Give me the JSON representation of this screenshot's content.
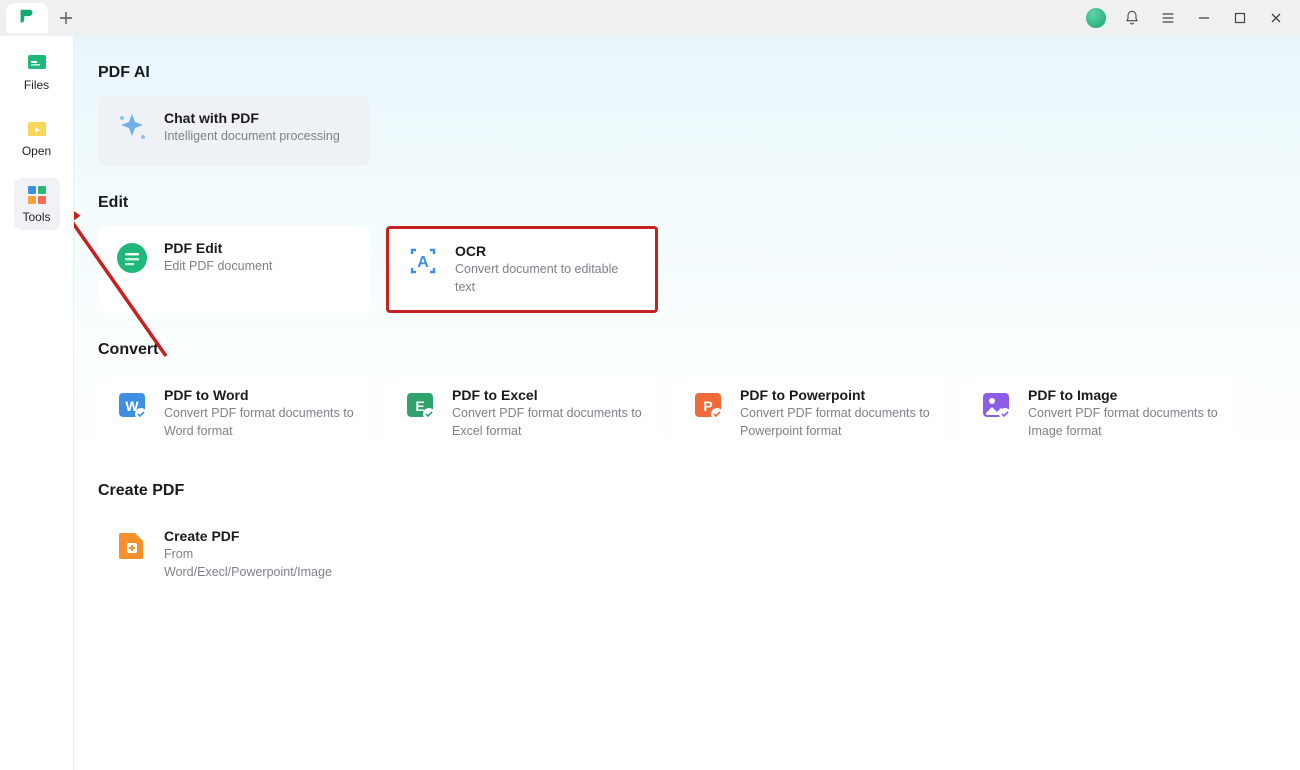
{
  "sidebar": {
    "items": [
      {
        "label": "Files"
      },
      {
        "label": "Open"
      },
      {
        "label": "Tools"
      }
    ]
  },
  "sections": {
    "ai": {
      "title": "PDF AI",
      "cards": [
        {
          "title": "Chat with PDF",
          "desc": "Intelligent document processing"
        }
      ]
    },
    "edit": {
      "title": "Edit",
      "cards": [
        {
          "title": "PDF Edit",
          "desc": "Edit PDF document"
        },
        {
          "title": "OCR",
          "desc": "Convert document to editable text"
        }
      ]
    },
    "convert": {
      "title": "Convert",
      "cards": [
        {
          "title": "PDF to Word",
          "desc": "Convert PDF format documents to Word format"
        },
        {
          "title": "PDF to Excel",
          "desc": "Convert PDF format documents to Excel format"
        },
        {
          "title": "PDF to Powerpoint",
          "desc": "Convert PDF format documents to Powerpoint format"
        },
        {
          "title": "PDF to Image",
          "desc": "Convert PDF format documents to Image format"
        }
      ]
    },
    "create": {
      "title": "Create PDF",
      "cards": [
        {
          "title": "Create PDF",
          "desc": "From Word/Execl/Powerpoint/Image"
        }
      ]
    }
  },
  "colors": {
    "highlight": "#c62020",
    "accent_green": "#16a871",
    "word_blue": "#3e8fe3",
    "excel_green": "#2fa36b",
    "ppt_orange": "#f06a3a",
    "image_purple": "#8e5de6",
    "ocr_blue": "#3e8fe3",
    "create_orange": "#f6902c"
  }
}
